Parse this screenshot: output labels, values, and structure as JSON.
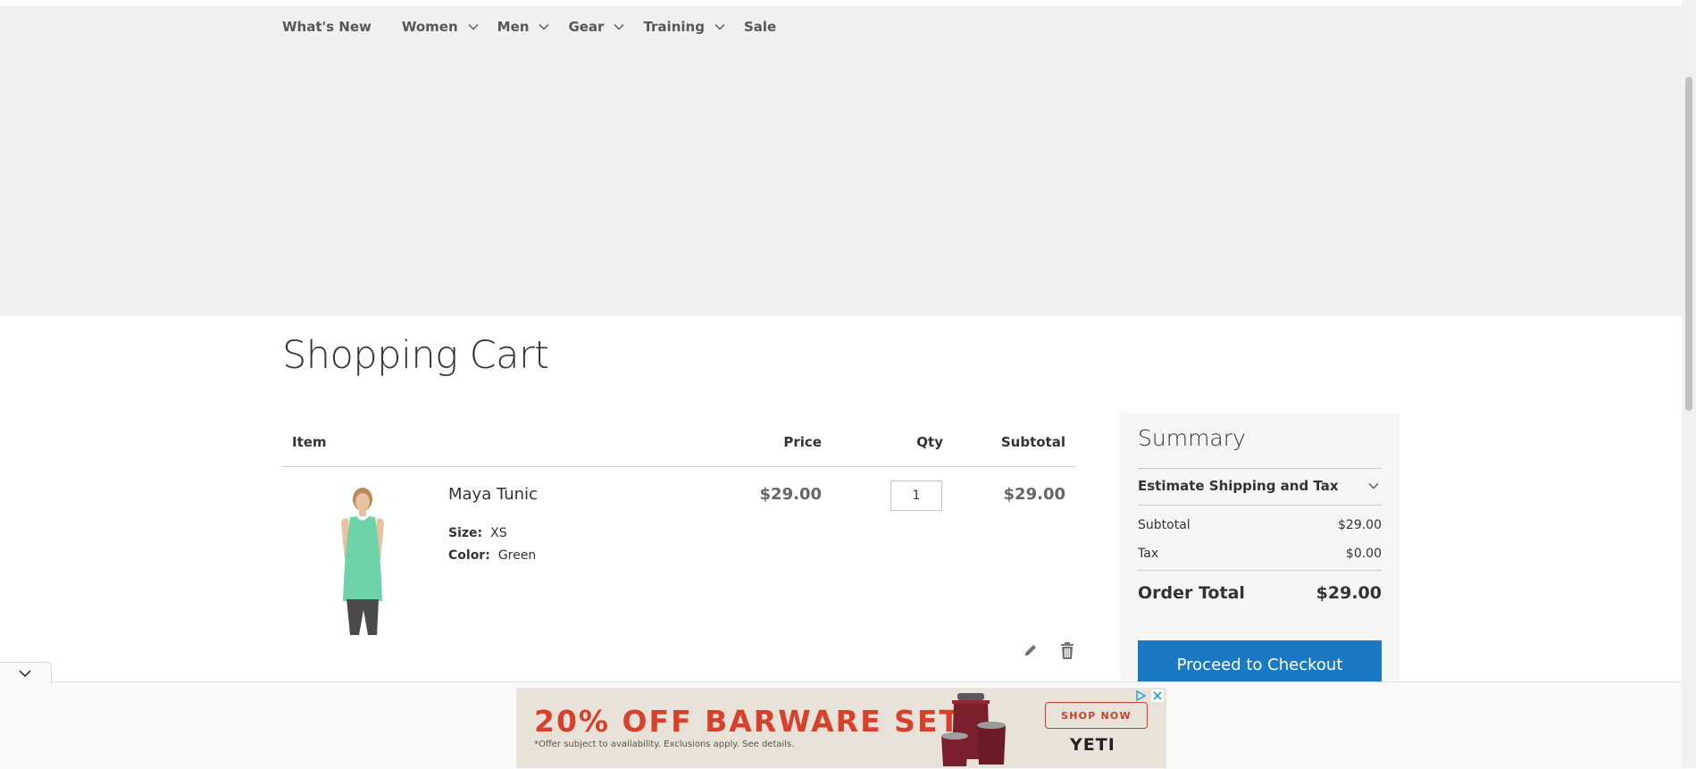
{
  "nav": {
    "items": [
      {
        "label": "What's New",
        "has_menu": false
      },
      {
        "label": "Women",
        "has_menu": true
      },
      {
        "label": "Men",
        "has_menu": true
      },
      {
        "label": "Gear",
        "has_menu": true
      },
      {
        "label": "Training",
        "has_menu": true
      },
      {
        "label": "Sale",
        "has_menu": false
      }
    ]
  },
  "page": {
    "title": "Shopping Cart"
  },
  "cart": {
    "headers": {
      "item": "Item",
      "price": "Price",
      "qty": "Qty",
      "subtotal": "Subtotal"
    },
    "items": [
      {
        "name": "Maya Tunic",
        "size_label": "Size:",
        "size": "XS",
        "color_label": "Color:",
        "color": "Green",
        "price": "$29.00",
        "qty": "1",
        "subtotal": "$29.00"
      }
    ]
  },
  "summary": {
    "title": "Summary",
    "estimate_label": "Estimate Shipping and Tax",
    "subtotal_label": "Subtotal",
    "subtotal": "$29.00",
    "tax_label": "Tax",
    "tax": "$0.00",
    "total_label": "Order Total",
    "total": "$29.00",
    "checkout_label": "Proceed to Checkout"
  },
  "ad": {
    "headline": "20% OFF BARWARE SETS",
    "fine_print": "*Offer subject to availability. Exclusions apply. See details.",
    "cta": "SHOP NOW",
    "brand": "YETI"
  },
  "colors": {
    "accent": "#1979c3",
    "nav_band": "#f0f0f0",
    "ad_headline": "#d7402b",
    "product": "#6ed3a8"
  },
  "icons": [
    "chevron-down-icon",
    "edit-icon",
    "delete-icon",
    "ad-choices-icon",
    "close-icon"
  ]
}
